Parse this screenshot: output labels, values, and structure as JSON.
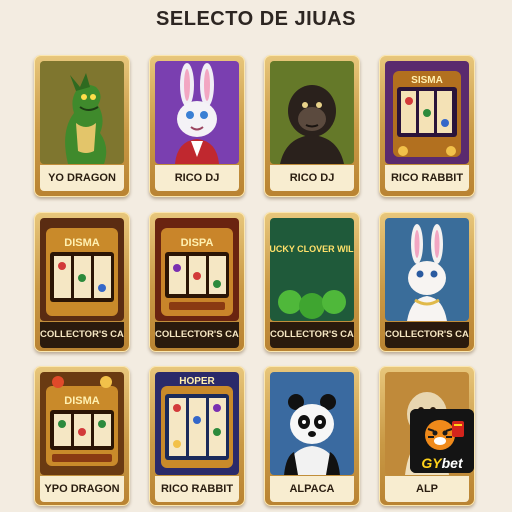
{
  "page": {
    "title": "SELECTO DE JIUAS"
  },
  "cards": [
    {
      "label": "YO DRAGON",
      "art": "green-dragon"
    },
    {
      "label": "RICO DJ",
      "art": "white-rabbit"
    },
    {
      "label": "RICO DJ",
      "art": "gorilla"
    },
    {
      "label": "RICO RABBIT",
      "art": "slot-machine",
      "art_text": "SISMA"
    },
    {
      "label": "COLLECTOR'S CARD",
      "art": "slot-machine",
      "art_text": "DISMA"
    },
    {
      "label": "COLLECTOR'S CARD",
      "art": "slot-machine",
      "art_text": "DISPA"
    },
    {
      "label": "COLLECTOR'S CARD",
      "art": "lucky-clover-wild",
      "art_text": "LUCKY CLOVER WILD"
    },
    {
      "label": "COLLECTOR'S CARD",
      "art": "white-bunny"
    },
    {
      "label": "YPO DRAGON",
      "art": "slot-machine",
      "art_text": "DISMA"
    },
    {
      "label": "RICO RABBIT",
      "art": "slot-machine",
      "art_text": "HOPER"
    },
    {
      "label": "ALPACA",
      "art": "panda"
    },
    {
      "label": "ALP",
      "art": "alpaca"
    }
  ],
  "logo": {
    "brand_prefix": "GY",
    "brand_suffix": "bet",
    "art": "tiger-mascot"
  },
  "colors": {
    "frame": "#c99945",
    "background": "#f3ece1",
    "collector_label_bg": "#2a1a0d"
  }
}
